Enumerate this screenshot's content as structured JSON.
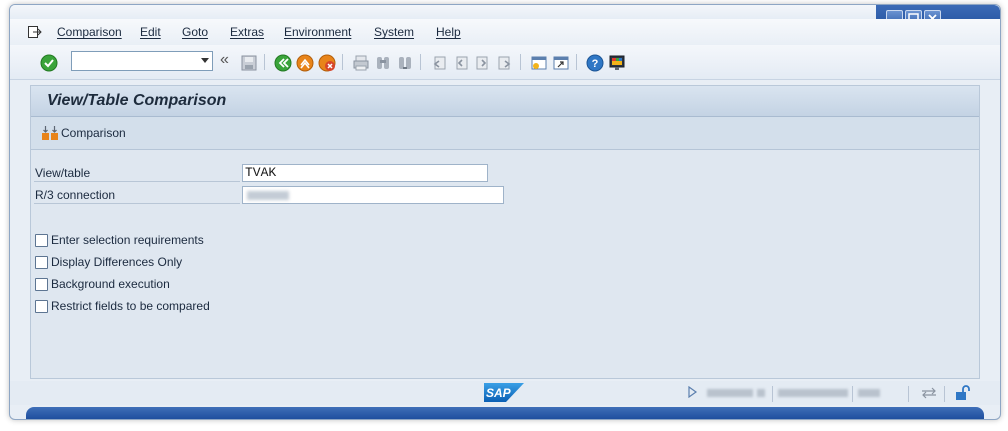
{
  "menubar": {
    "items": [
      "Comparison",
      "Edit",
      "Goto",
      "Extras",
      "Environment",
      "System",
      "Help"
    ]
  },
  "toolbar": {
    "command_field_value": "",
    "icons": [
      "enter-icon",
      "save-icon",
      "back-icon",
      "exit-icon",
      "cancel-icon",
      "print-icon",
      "find-icon",
      "find-next-icon",
      "first-page-icon",
      "previous-page-icon",
      "next-page-icon",
      "last-page-icon",
      "create-session-icon",
      "shortcut-icon",
      "help-icon",
      "customize-layout-icon"
    ]
  },
  "screen": {
    "title": "View/Table Comparison",
    "app_button_label": "Comparison"
  },
  "fields": {
    "view_table": {
      "label": "View/table",
      "value": "TVAK"
    },
    "r3_connection": {
      "label": "R/3 connection",
      "value": ""
    }
  },
  "checkboxes": [
    {
      "label": "Enter selection requirements",
      "checked": false
    },
    {
      "label": "Display Differences Only",
      "checked": false
    },
    {
      "label": "Background execution",
      "checked": false
    },
    {
      "label": "Restrict fields to be compared",
      "checked": false
    }
  ],
  "statusbar": {
    "logo": "SAP"
  },
  "colors": {
    "accent": "#1f4f9e",
    "enter_green": "#3aa43a",
    "exit_orange": "#e8841a",
    "cancel_red": "#d7452b"
  }
}
